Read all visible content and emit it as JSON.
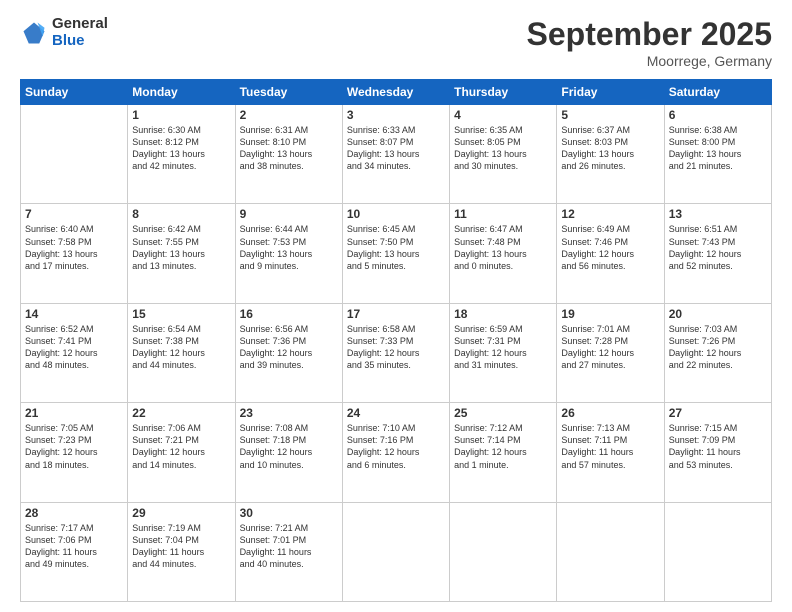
{
  "logo": {
    "general": "General",
    "blue": "Blue"
  },
  "header": {
    "month": "September 2025",
    "location": "Moorrege, Germany"
  },
  "days": [
    "Sunday",
    "Monday",
    "Tuesday",
    "Wednesday",
    "Thursday",
    "Friday",
    "Saturday"
  ],
  "weeks": [
    [
      {
        "num": "",
        "info": ""
      },
      {
        "num": "1",
        "info": "Sunrise: 6:30 AM\nSunset: 8:12 PM\nDaylight: 13 hours\nand 42 minutes."
      },
      {
        "num": "2",
        "info": "Sunrise: 6:31 AM\nSunset: 8:10 PM\nDaylight: 13 hours\nand 38 minutes."
      },
      {
        "num": "3",
        "info": "Sunrise: 6:33 AM\nSunset: 8:07 PM\nDaylight: 13 hours\nand 34 minutes."
      },
      {
        "num": "4",
        "info": "Sunrise: 6:35 AM\nSunset: 8:05 PM\nDaylight: 13 hours\nand 30 minutes."
      },
      {
        "num": "5",
        "info": "Sunrise: 6:37 AM\nSunset: 8:03 PM\nDaylight: 13 hours\nand 26 minutes."
      },
      {
        "num": "6",
        "info": "Sunrise: 6:38 AM\nSunset: 8:00 PM\nDaylight: 13 hours\nand 21 minutes."
      }
    ],
    [
      {
        "num": "7",
        "info": "Sunrise: 6:40 AM\nSunset: 7:58 PM\nDaylight: 13 hours\nand 17 minutes."
      },
      {
        "num": "8",
        "info": "Sunrise: 6:42 AM\nSunset: 7:55 PM\nDaylight: 13 hours\nand 13 minutes."
      },
      {
        "num": "9",
        "info": "Sunrise: 6:44 AM\nSunset: 7:53 PM\nDaylight: 13 hours\nand 9 minutes."
      },
      {
        "num": "10",
        "info": "Sunrise: 6:45 AM\nSunset: 7:50 PM\nDaylight: 13 hours\nand 5 minutes."
      },
      {
        "num": "11",
        "info": "Sunrise: 6:47 AM\nSunset: 7:48 PM\nDaylight: 13 hours\nand 0 minutes."
      },
      {
        "num": "12",
        "info": "Sunrise: 6:49 AM\nSunset: 7:46 PM\nDaylight: 12 hours\nand 56 minutes."
      },
      {
        "num": "13",
        "info": "Sunrise: 6:51 AM\nSunset: 7:43 PM\nDaylight: 12 hours\nand 52 minutes."
      }
    ],
    [
      {
        "num": "14",
        "info": "Sunrise: 6:52 AM\nSunset: 7:41 PM\nDaylight: 12 hours\nand 48 minutes."
      },
      {
        "num": "15",
        "info": "Sunrise: 6:54 AM\nSunset: 7:38 PM\nDaylight: 12 hours\nand 44 minutes."
      },
      {
        "num": "16",
        "info": "Sunrise: 6:56 AM\nSunset: 7:36 PM\nDaylight: 12 hours\nand 39 minutes."
      },
      {
        "num": "17",
        "info": "Sunrise: 6:58 AM\nSunset: 7:33 PM\nDaylight: 12 hours\nand 35 minutes."
      },
      {
        "num": "18",
        "info": "Sunrise: 6:59 AM\nSunset: 7:31 PM\nDaylight: 12 hours\nand 31 minutes."
      },
      {
        "num": "19",
        "info": "Sunrise: 7:01 AM\nSunset: 7:28 PM\nDaylight: 12 hours\nand 27 minutes."
      },
      {
        "num": "20",
        "info": "Sunrise: 7:03 AM\nSunset: 7:26 PM\nDaylight: 12 hours\nand 22 minutes."
      }
    ],
    [
      {
        "num": "21",
        "info": "Sunrise: 7:05 AM\nSunset: 7:23 PM\nDaylight: 12 hours\nand 18 minutes."
      },
      {
        "num": "22",
        "info": "Sunrise: 7:06 AM\nSunset: 7:21 PM\nDaylight: 12 hours\nand 14 minutes."
      },
      {
        "num": "23",
        "info": "Sunrise: 7:08 AM\nSunset: 7:18 PM\nDaylight: 12 hours\nand 10 minutes."
      },
      {
        "num": "24",
        "info": "Sunrise: 7:10 AM\nSunset: 7:16 PM\nDaylight: 12 hours\nand 6 minutes."
      },
      {
        "num": "25",
        "info": "Sunrise: 7:12 AM\nSunset: 7:14 PM\nDaylight: 12 hours\nand 1 minute."
      },
      {
        "num": "26",
        "info": "Sunrise: 7:13 AM\nSunset: 7:11 PM\nDaylight: 11 hours\nand 57 minutes."
      },
      {
        "num": "27",
        "info": "Sunrise: 7:15 AM\nSunset: 7:09 PM\nDaylight: 11 hours\nand 53 minutes."
      }
    ],
    [
      {
        "num": "28",
        "info": "Sunrise: 7:17 AM\nSunset: 7:06 PM\nDaylight: 11 hours\nand 49 minutes."
      },
      {
        "num": "29",
        "info": "Sunrise: 7:19 AM\nSunset: 7:04 PM\nDaylight: 11 hours\nand 44 minutes."
      },
      {
        "num": "30",
        "info": "Sunrise: 7:21 AM\nSunset: 7:01 PM\nDaylight: 11 hours\nand 40 minutes."
      },
      {
        "num": "",
        "info": ""
      },
      {
        "num": "",
        "info": ""
      },
      {
        "num": "",
        "info": ""
      },
      {
        "num": "",
        "info": ""
      }
    ]
  ]
}
